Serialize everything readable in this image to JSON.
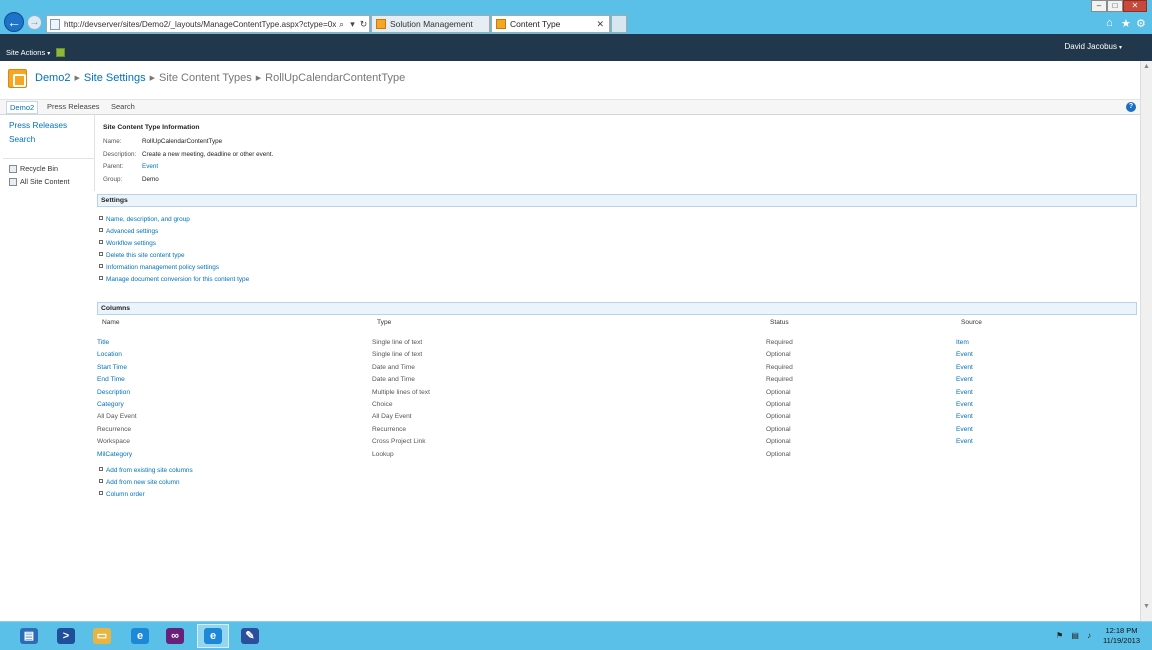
{
  "browser": {
    "back_glyph": "←",
    "forward_glyph": "→",
    "url": "http://devserver/sites/Demo2/_layouts/ManageContentType.aspx?ctype=0x010200F8FD",
    "search_glyph": "⌕",
    "dropdown_glyph": "▾",
    "refresh_glyph": "↻",
    "tabs": [
      {
        "label": "Solution Management",
        "active": false
      },
      {
        "label": "Content Type",
        "active": true
      }
    ],
    "tab_close": "✕",
    "home_glyph": "⌂",
    "favorites_glyph": "★",
    "tools_glyph": "⚙",
    "window_controls": [
      "–",
      "□",
      "✕"
    ]
  },
  "ribbon": {
    "site_actions": "Site Actions",
    "caret": "▾",
    "user": "David Jacobus"
  },
  "breadcrumb": {
    "site": "Demo2",
    "settings": "Site Settings",
    "content_types": "Site Content Types",
    "current": "RollUpCalendarContentType",
    "separator": "▶"
  },
  "topnav": {
    "items": [
      "Demo2",
      "Press Releases",
      "Search"
    ],
    "help": "?"
  },
  "leftnav": {
    "links": [
      "Press Releases",
      "Search"
    ],
    "recycle_bin": "Recycle Bin",
    "all_site_content": "All Site Content"
  },
  "info": {
    "heading": "Site Content Type Information",
    "name_label": "Name:",
    "name_value": "RollUpCalendarContentType",
    "description_label": "Description:",
    "description_value": "Create a new meeting, deadline or other event.",
    "parent_label": "Parent:",
    "parent_value": "Event",
    "group_label": "Group:",
    "group_value": "Demo"
  },
  "settings": {
    "heading": "Settings",
    "links": [
      "Name, description, and group",
      "Advanced settings",
      "Workflow settings",
      "Delete this site content type",
      "Information management policy settings",
      "Manage document conversion for this content type"
    ]
  },
  "columns": {
    "heading": "Columns",
    "headers": {
      "name": "Name",
      "type": "Type",
      "status": "Status",
      "source": "Source"
    },
    "rows": [
      {
        "name": "Title",
        "type": "Single line of text",
        "status": "Required",
        "source": "Item",
        "link": true
      },
      {
        "name": "Location",
        "type": "Single line of text",
        "status": "Optional",
        "source": "Event",
        "link": true
      },
      {
        "name": "Start Time",
        "type": "Date and Time",
        "status": "Required",
        "source": "Event",
        "link": true
      },
      {
        "name": "End Time",
        "type": "Date and Time",
        "status": "Required",
        "source": "Event",
        "link": true
      },
      {
        "name": "Description",
        "type": "Multiple lines of text",
        "status": "Optional",
        "source": "Event",
        "link": true
      },
      {
        "name": "Category",
        "type": "Choice",
        "status": "Optional",
        "source": "Event",
        "link": true
      },
      {
        "name": "All Day Event",
        "type": "All Day Event",
        "status": "Optional",
        "source": "Event",
        "link": false
      },
      {
        "name": "Recurrence",
        "type": "Recurrence",
        "status": "Optional",
        "source": "Event",
        "link": false
      },
      {
        "name": "Workspace",
        "type": "Cross Project Link",
        "status": "Optional",
        "source": "Event",
        "link": false
      },
      {
        "name": "MilCategory",
        "type": "Lookup",
        "status": "Optional",
        "source": "",
        "link": true
      }
    ],
    "actions": [
      "Add from existing site columns",
      "Add from new site column",
      "Column order"
    ]
  },
  "scrollbar": {
    "up": "▲",
    "down": "▼"
  },
  "taskbar": {
    "buttons": [
      {
        "name": "server-manager",
        "glyph": "▤",
        "color": "#2a6db5",
        "active": false
      },
      {
        "name": "powershell",
        "glyph": ">",
        "color": "#1f4f9a",
        "active": false
      },
      {
        "name": "file-explorer",
        "glyph": "▭",
        "color": "#e8b543",
        "active": false
      },
      {
        "name": "internet-explorer",
        "glyph": "e",
        "color": "#1e88d8",
        "active": false
      },
      {
        "name": "visual-studio",
        "glyph": "∞",
        "color": "#68217a",
        "active": false
      },
      {
        "name": "internet-explorer-2",
        "glyph": "e",
        "color": "#1e88d8",
        "active": true
      },
      {
        "name": "paint-app",
        "glyph": "✎",
        "color": "#2b4f9c",
        "active": false
      }
    ],
    "tray_icons": "⚑ ▤ ♪",
    "time": "12:18 PM",
    "date": "11/19/2013"
  }
}
